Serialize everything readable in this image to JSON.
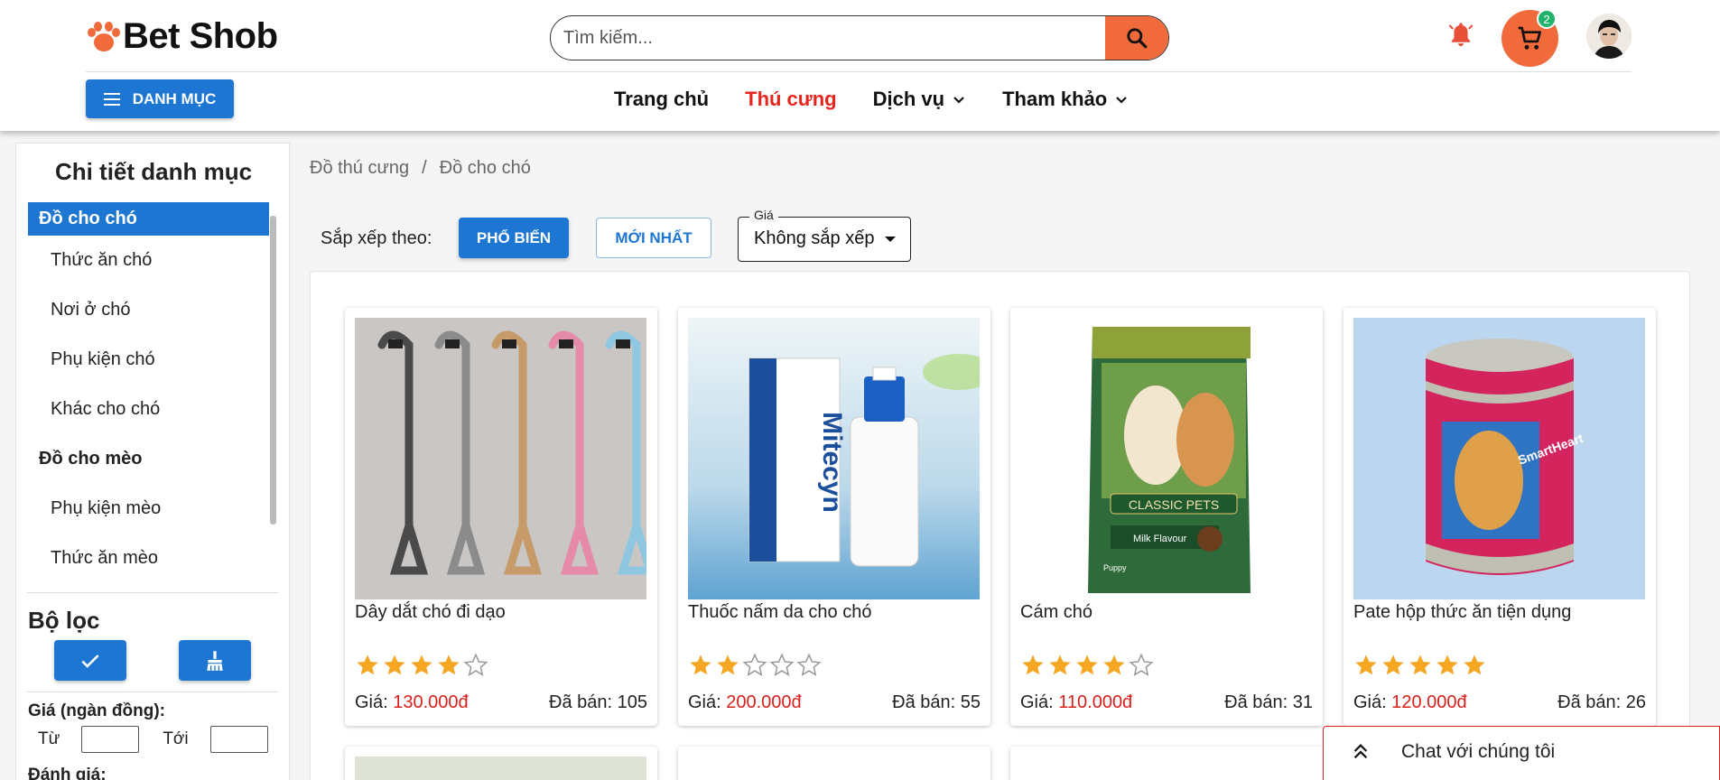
{
  "header": {
    "logo_text": "Bet Shob",
    "search": {
      "placeholder": "Tìm kiếm..."
    },
    "cart_count": "2",
    "category_button": "DANH MỤC",
    "nav": [
      {
        "label": "Trang chủ",
        "active": false
      },
      {
        "label": "Thú cưng",
        "active": true
      },
      {
        "label": "Dịch vụ",
        "dropdown": true
      },
      {
        "label": "Tham khảo",
        "dropdown": true
      }
    ]
  },
  "sidebar": {
    "title": "Chi tiết danh mục",
    "categories": [
      {
        "label": "Đồ cho chó",
        "type": "group",
        "selected": true
      },
      {
        "label": "Thức ăn chó",
        "type": "child"
      },
      {
        "label": "Nơi ở chó",
        "type": "child"
      },
      {
        "label": "Phụ kiện chó",
        "type": "child"
      },
      {
        "label": "Khác cho chó",
        "type": "child"
      },
      {
        "label": "Đồ cho mèo",
        "type": "group"
      },
      {
        "label": "Phụ kiện mèo",
        "type": "child"
      },
      {
        "label": "Thức ăn mèo",
        "type": "child"
      }
    ],
    "filter_title": "Bộ lọc",
    "price_label": "Giá (ngàn đồng):",
    "from_label": "Từ",
    "to_label": "Tới",
    "rating_label": "Đánh giá:"
  },
  "main": {
    "breadcrumb": [
      "Đồ thú cưng",
      "Đồ cho chó"
    ],
    "sort_label": "Sắp xếp theo:",
    "sort_popular": "PHỔ BIẾN",
    "sort_newest": "MỚI NHẤT",
    "price_select": {
      "legend": "Giá",
      "value": "Không sắp xếp"
    },
    "price_prefix": "Giá: ",
    "sold_prefix": "Đã bán: ",
    "products": [
      {
        "name": "Dây dắt chó đi dạo",
        "rating": 4,
        "price": "130.000đ",
        "sold": "105"
      },
      {
        "name": "Thuốc nấm da cho chó",
        "rating": 2,
        "price": "200.000đ",
        "sold": "55"
      },
      {
        "name": "Cám chó",
        "rating": 4,
        "price": "110.000đ",
        "sold": "31"
      },
      {
        "name": "Pate hộp thức ăn tiện dụng",
        "rating": 5,
        "price": "120.000đ",
        "sold": "26"
      }
    ],
    "product_image_labels": {
      "mitecyn": "Mitecyn",
      "classic_pets": "CLASSIC PETS",
      "milk_flavour": "Milk Flavour",
      "puppy": "Puppy",
      "smartheart": "SmartHeart"
    }
  },
  "chat": {
    "label": "Chat với chúng tôi"
  },
  "colors": {
    "primary": "#1d76d2",
    "accent": "#f06a3b",
    "price": "#d8201c",
    "star": "#f5a623",
    "active_nav": "#e8241f"
  }
}
